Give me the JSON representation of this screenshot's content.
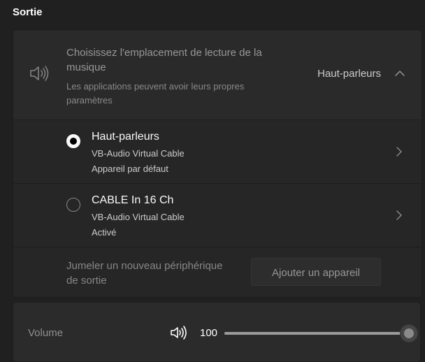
{
  "section": {
    "title": "Sortie"
  },
  "output": {
    "icon": "speaker-icon",
    "title": "Choisissez l'emplacement de lecture de la musique",
    "subtitle": "Les applications peuvent avoir leurs propres paramètres",
    "selected_value": "Haut-parleurs",
    "expanded": true,
    "chevron_icon": "chevron-up-icon",
    "devices": [
      {
        "name": "Haut-parleurs",
        "description": "VB-Audio Virtual Cable",
        "status": "Appareil par défaut",
        "selected": true,
        "chevron_icon": "chevron-right-icon"
      },
      {
        "name": "CABLE In 16 Ch",
        "description": "VB-Audio Virtual Cable",
        "status": "Activé",
        "selected": false,
        "chevron_icon": "chevron-right-icon"
      }
    ],
    "pair": {
      "text": "Jumeler un nouveau périphérique de sortie",
      "button_label": "Ajouter un appareil"
    }
  },
  "volume": {
    "label": "Volume",
    "icon": "speaker-icon",
    "value": "100",
    "level": 1.0
  },
  "colors": {
    "background": "#202020",
    "card": "#2b2b2b",
    "row": "#272727",
    "text_primary": "#ffffff",
    "text_muted": "#8a8a8a"
  }
}
